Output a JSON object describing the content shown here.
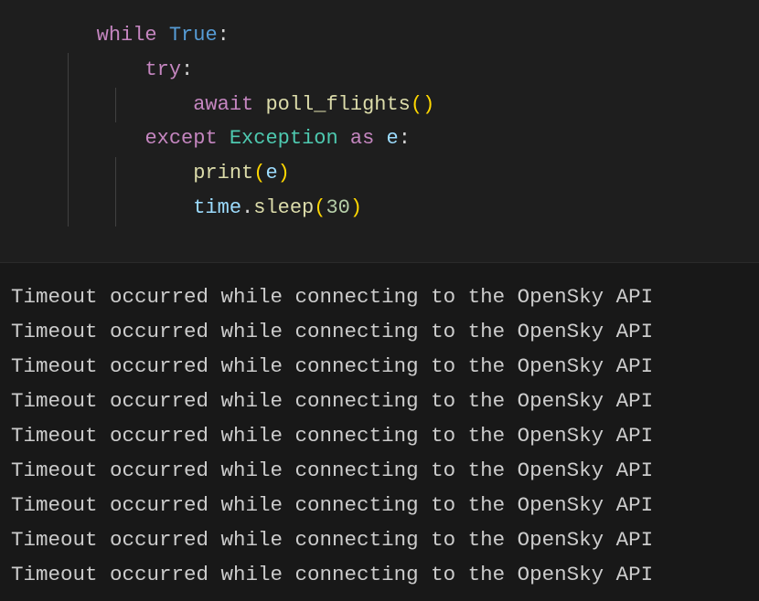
{
  "code": {
    "line1": {
      "while": "while",
      "true": "True",
      "colon": ":"
    },
    "line2": {
      "try": "try",
      "colon": ":"
    },
    "line3": {
      "await": "await",
      "fn": "poll_flights",
      "lp": "(",
      "rp": ")"
    },
    "line4": {
      "except": "except",
      "exception": "Exception",
      "as": "as",
      "e": "e",
      "colon": ":"
    },
    "line5": {
      "print": "print",
      "lp": "(",
      "e": "e",
      "rp": ")"
    },
    "line6": {
      "time": "time",
      "dot": ".",
      "sleep": "sleep",
      "lp": "(",
      "num": "30",
      "rp": ")"
    }
  },
  "terminal": {
    "message": "Timeout occurred while connecting to the OpenSky API",
    "count": 9
  }
}
